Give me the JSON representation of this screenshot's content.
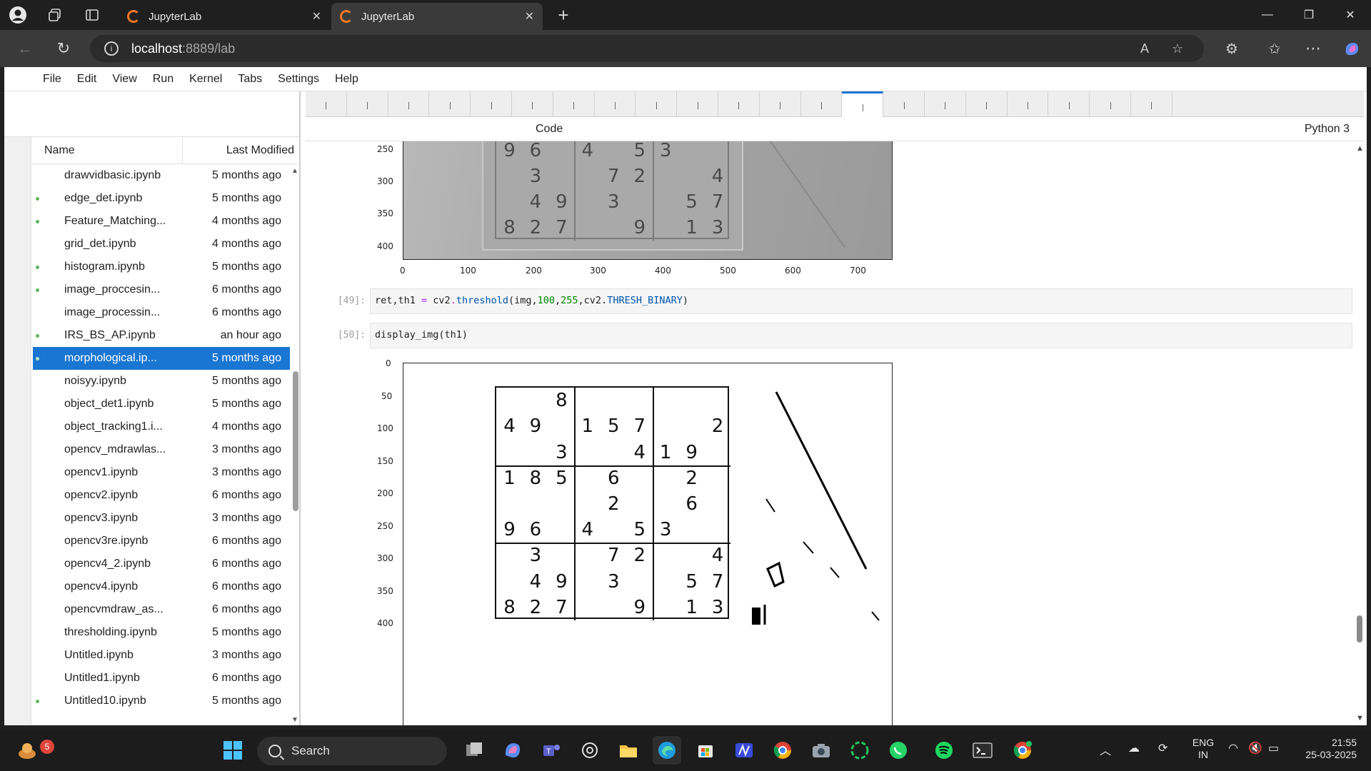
{
  "browser": {
    "tabs": [
      {
        "title": "JupyterLab",
        "active": false
      },
      {
        "title": "JupyterLab",
        "active": true
      }
    ],
    "url_host": "localhost",
    "url_rest": ":8889/lab"
  },
  "menu": [
    "File",
    "Edit",
    "View",
    "Run",
    "Kernel",
    "Tabs",
    "Settings",
    "Help"
  ],
  "file_browser": {
    "col_name": "Name",
    "col_modified": "Last Modified",
    "files": [
      {
        "name": "drawvidbasic.ipynb",
        "modified": "5 months ago",
        "running": false,
        "selected": false
      },
      {
        "name": "edge_det.ipynb",
        "modified": "5 months ago",
        "running": true,
        "selected": false
      },
      {
        "name": "Feature_Matching...",
        "modified": "4 months ago",
        "running": true,
        "selected": false
      },
      {
        "name": "grid_det.ipynb",
        "modified": "4 months ago",
        "running": false,
        "selected": false
      },
      {
        "name": "histogram.ipynb",
        "modified": "5 months ago",
        "running": true,
        "selected": false
      },
      {
        "name": "image_proccesin...",
        "modified": "6 months ago",
        "running": true,
        "selected": false
      },
      {
        "name": "image_processin...",
        "modified": "6 months ago",
        "running": false,
        "selected": false
      },
      {
        "name": "IRS_BS_AP.ipynb",
        "modified": "an hour ago",
        "running": true,
        "selected": false
      },
      {
        "name": "morphological.ip...",
        "modified": "5 months ago",
        "running": true,
        "selected": true
      },
      {
        "name": "noisyy.ipynb",
        "modified": "5 months ago",
        "running": false,
        "selected": false
      },
      {
        "name": "object_det1.ipynb",
        "modified": "5 months ago",
        "running": false,
        "selected": false
      },
      {
        "name": "object_tracking1.i...",
        "modified": "4 months ago",
        "running": false,
        "selected": false
      },
      {
        "name": "opencv_mdrawlas...",
        "modified": "3 months ago",
        "running": false,
        "selected": false
      },
      {
        "name": "opencv1.ipynb",
        "modified": "3 months ago",
        "running": false,
        "selected": false
      },
      {
        "name": "opencv2.ipynb",
        "modified": "6 months ago",
        "running": false,
        "selected": false
      },
      {
        "name": "opencv3.ipynb",
        "modified": "3 months ago",
        "running": false,
        "selected": false
      },
      {
        "name": "opencv3re.ipynb",
        "modified": "6 months ago",
        "running": false,
        "selected": false
      },
      {
        "name": "opencv4_2.ipynb",
        "modified": "6 months ago",
        "running": false,
        "selected": false
      },
      {
        "name": "opencv4.ipynb",
        "modified": "6 months ago",
        "running": false,
        "selected": false
      },
      {
        "name": "opencvmdraw_as...",
        "modified": "6 months ago",
        "running": false,
        "selected": false
      },
      {
        "name": "thresholding.ipynb",
        "modified": "5 months ago",
        "running": false,
        "selected": false
      },
      {
        "name": "Untitled.ipynb",
        "modified": "3 months ago",
        "running": false,
        "selected": false
      },
      {
        "name": "Untitled1.ipynb",
        "modified": "6 months ago",
        "running": false,
        "selected": false
      },
      {
        "name": "Untitled10.ipynb",
        "modified": "5 months ago",
        "running": true,
        "selected": false
      }
    ]
  },
  "notebook": {
    "cell_type": "Code",
    "kernel": "Python 3",
    "cells": [
      {
        "prompt": "[49]:",
        "code_parts": [
          "ret,th1 ",
          "= ",
          "cv2",
          ".",
          "threshold",
          "(img,",
          "100",
          ",",
          "255",
          ",cv2.",
          "THRESH_BINARY",
          ")"
        ]
      },
      {
        "prompt": "[50]:",
        "code": "display_img(th1)"
      }
    ],
    "plot1": {
      "y_ticks": [
        "250",
        "300",
        "350",
        "400"
      ],
      "x_ticks": [
        "0",
        "100",
        "200",
        "300",
        "400",
        "500",
        "600",
        "700"
      ]
    },
    "plot2": {
      "y_ticks": [
        "0",
        "50",
        "100",
        "150",
        "200",
        "250",
        "300",
        "350",
        "400"
      ]
    },
    "sudoku_top_rows": [
      [
        "9",
        "6",
        "",
        "4",
        "",
        "5",
        "3",
        "",
        ""
      ],
      [
        "",
        "3",
        "",
        "",
        "7",
        "2",
        "",
        "",
        "4"
      ],
      [
        "",
        "4",
        "9",
        "",
        "3",
        "",
        "",
        "5",
        "7"
      ],
      [
        "8",
        "2",
        "7",
        "",
        "",
        "9",
        "",
        "1",
        "3"
      ]
    ],
    "sudoku_bottom_rows": [
      [
        "",
        "",
        "8",
        "",
        "",
        "",
        "",
        "",
        ""
      ],
      [
        "4",
        "9",
        "",
        "1",
        "5",
        "7",
        "",
        "",
        "2"
      ],
      [
        "",
        "",
        "3",
        "",
        "",
        "4",
        "1",
        "9",
        ""
      ],
      [
        "1",
        "8",
        "5",
        "",
        "6",
        "",
        "",
        "2",
        ""
      ],
      [
        "",
        "",
        "",
        "",
        "2",
        "",
        "",
        "6",
        ""
      ],
      [
        "9",
        "6",
        "",
        "4",
        "",
        "5",
        "3",
        "",
        ""
      ],
      [
        "",
        "3",
        "",
        "",
        "7",
        "2",
        "",
        "",
        "4"
      ],
      [
        "",
        "4",
        "9",
        "",
        "3",
        "",
        "",
        "5",
        "7"
      ],
      [
        "8",
        "2",
        "7",
        "",
        "",
        "9",
        "",
        "1",
        "3"
      ]
    ]
  },
  "taskbar": {
    "search": "Search",
    "notification_count": "5",
    "lang_line1": "ENG",
    "lang_line2": "IN",
    "time": "21:55",
    "date": "25-03-2025"
  }
}
